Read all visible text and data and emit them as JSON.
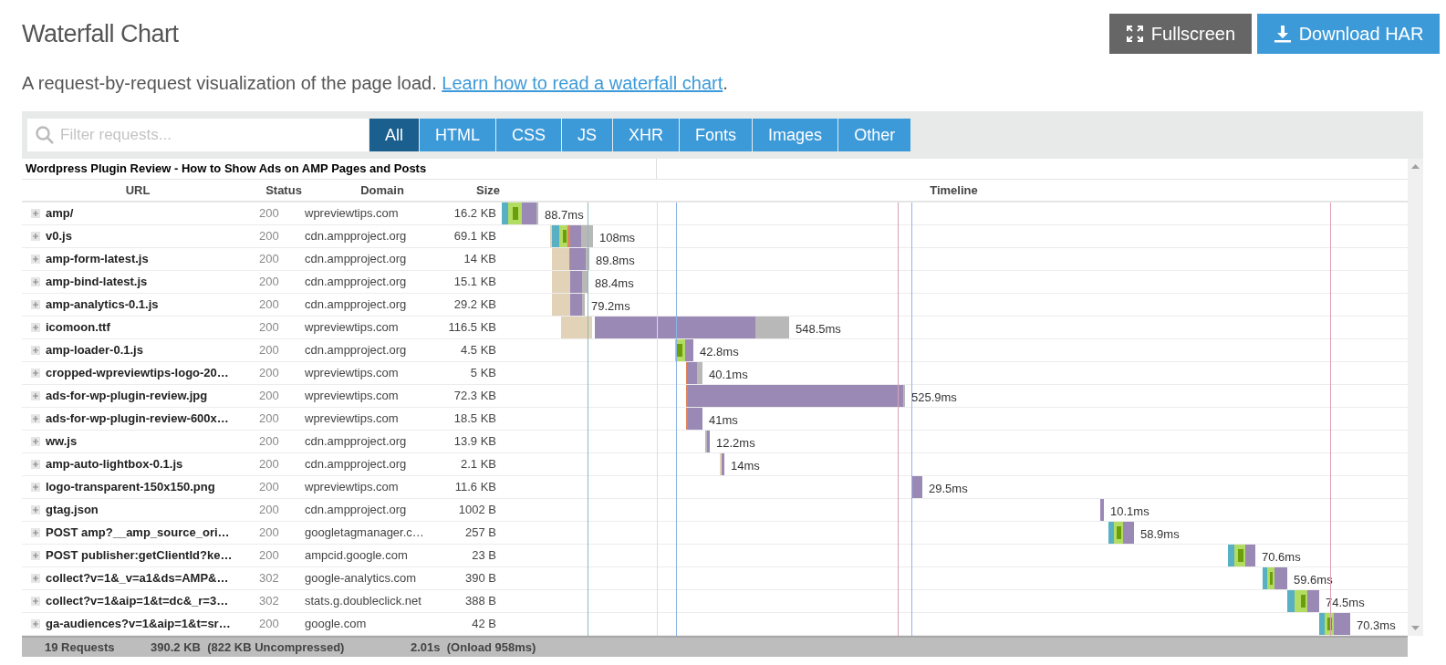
{
  "title": "Waterfall Chart",
  "buttons": [
    {
      "kind": "fullscreen",
      "label": "Fullscreen"
    },
    {
      "kind": "download",
      "label": "Download HAR"
    }
  ],
  "description": {
    "text": "A request-by-request visualization of the page load.",
    "link": "Learn how to read a waterfall chart",
    "after": "."
  },
  "filter": {
    "placeholder": "Filter requests..."
  },
  "tabs": [
    {
      "label": "All",
      "selected": true
    },
    {
      "label": "HTML",
      "selected": false
    },
    {
      "label": "CSS",
      "selected": false
    },
    {
      "label": "JS",
      "selected": false
    },
    {
      "label": "XHR",
      "selected": false
    },
    {
      "label": "Fonts",
      "selected": false
    },
    {
      "label": "Images",
      "selected": false
    },
    {
      "label": "Other",
      "selected": false
    }
  ],
  "table": {
    "page_title": "Wordpress Plugin Review - How to Show Ads on AMP Pages and Posts",
    "columns": [
      "URL",
      "Status",
      "Domain",
      "Size",
      "Timeline"
    ],
    "rows": [
      {
        "url": "amp/",
        "status": "200",
        "domain": "wpreviewtips.com",
        "size": "16.2 KB",
        "duration": "88.7ms"
      },
      {
        "url": "v0.js",
        "status": "200",
        "domain": "cdn.ampproject.org",
        "size": "69.1 KB",
        "duration": "108ms"
      },
      {
        "url": "amp-form-latest.js",
        "status": "200",
        "domain": "cdn.ampproject.org",
        "size": "14 KB",
        "duration": "89.8ms"
      },
      {
        "url": "amp-bind-latest.js",
        "status": "200",
        "domain": "cdn.ampproject.org",
        "size": "15.1 KB",
        "duration": "88.4ms"
      },
      {
        "url": "amp-analytics-0.1.js",
        "status": "200",
        "domain": "cdn.ampproject.org",
        "size": "29.2 KB",
        "duration": "79.2ms"
      },
      {
        "url": "icomoon.ttf",
        "status": "200",
        "domain": "wpreviewtips.com",
        "size": "116.5 KB",
        "duration": "548.5ms"
      },
      {
        "url": "amp-loader-0.1.js",
        "status": "200",
        "domain": "cdn.ampproject.org",
        "size": "4.5 KB",
        "duration": "42.8ms"
      },
      {
        "url": "cropped-wpreviewtips-logo-20…",
        "status": "200",
        "domain": "wpreviewtips.com",
        "size": "5 KB",
        "duration": "40.1ms"
      },
      {
        "url": "ads-for-wp-plugin-review.jpg",
        "status": "200",
        "domain": "wpreviewtips.com",
        "size": "72.3 KB",
        "duration": "525.9ms"
      },
      {
        "url": "ads-for-wp-plugin-review-600x…",
        "status": "200",
        "domain": "wpreviewtips.com",
        "size": "18.5 KB",
        "duration": "41ms"
      },
      {
        "url": "ww.js",
        "status": "200",
        "domain": "cdn.ampproject.org",
        "size": "13.9 KB",
        "duration": "12.2ms"
      },
      {
        "url": "amp-auto-lightbox-0.1.js",
        "status": "200",
        "domain": "cdn.ampproject.org",
        "size": "2.1 KB",
        "duration": "14ms"
      },
      {
        "url": "logo-transparent-150x150.png",
        "status": "200",
        "domain": "wpreviewtips.com",
        "size": "11.6 KB",
        "duration": "29.5ms"
      },
      {
        "url": "gtag.json",
        "status": "200",
        "domain": "cdn.ampproject.org",
        "size": "1002 B",
        "duration": "10.1ms"
      },
      {
        "url": "POST amp?__amp_source_ori…",
        "status": "200",
        "domain": "googletagmanager.c…",
        "size": "257 B",
        "duration": "58.9ms"
      },
      {
        "url": "POST publisher:getClientId?ke…",
        "status": "200",
        "domain": "ampcid.google.com",
        "size": "23 B",
        "duration": "70.6ms"
      },
      {
        "url": "collect?v=1&_v=a1&ds=AMP&…",
        "status": "302",
        "domain": "google-analytics.com",
        "size": "390 B",
        "duration": "59.6ms"
      },
      {
        "url": "collect?v=1&aip=1&t=dc&_r=3…",
        "status": "302",
        "domain": "stats.g.doubleclick.net",
        "size": "388 B",
        "duration": "74.5ms"
      },
      {
        "url": "ga-audiences?v=1&aip=1&t=sr…",
        "status": "200",
        "domain": "google.com",
        "size": "42 B",
        "duration": "70.3ms"
      }
    ]
  },
  "footer": {
    "requests": "19 Requests",
    "size": "390.2 KB  (822 KB Uncompressed)",
    "time": "2.01s  (Onload 958ms)"
  }
}
